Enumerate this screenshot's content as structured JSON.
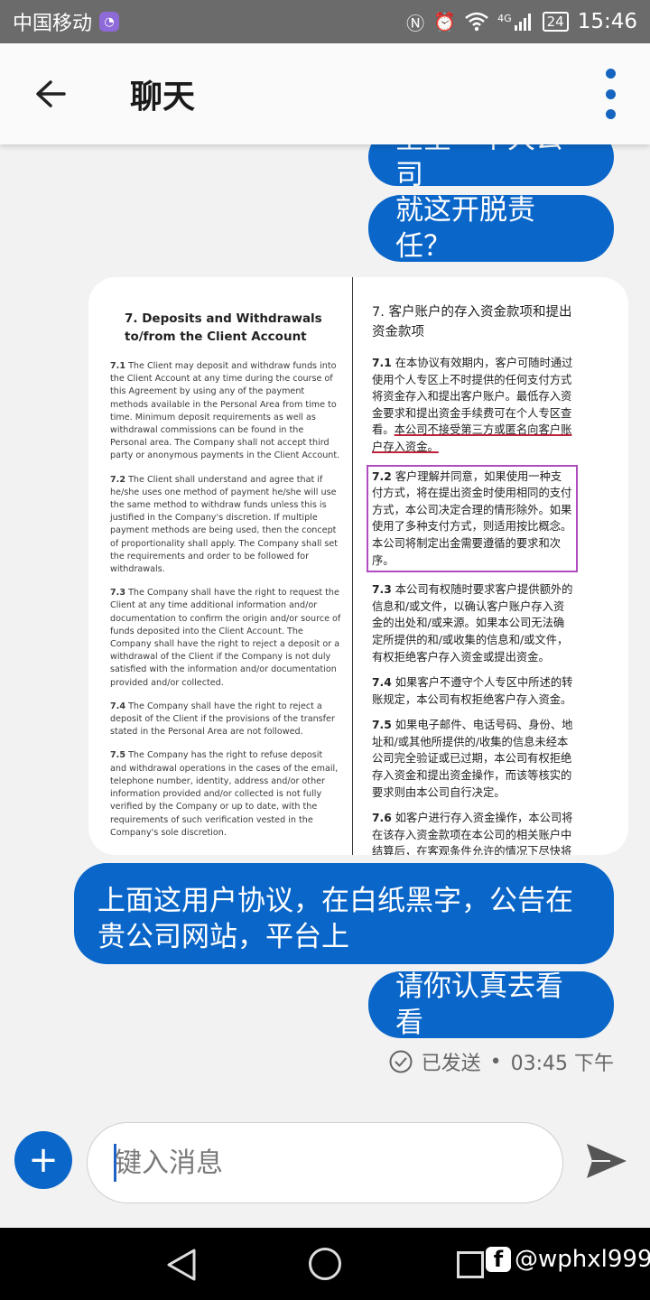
{
  "status_bar": {
    "carrier": "中国移动",
    "time": "15:46",
    "battery": "24",
    "network": "4G"
  },
  "header": {
    "title": "聊天"
  },
  "messages": [
    {
      "text": "堂堂一个大公司"
    },
    {
      "text": "就这开脱责任？"
    },
    {
      "text": "上面这用户协议，在白纸黑字，公告在贵公司网站，平台上"
    },
    {
      "text": "请你认真去看看"
    }
  ],
  "document": {
    "en_title": "7. Deposits and Withdrawals to/from the Client Account",
    "en_paragraphs": [
      {
        "num": "7.1",
        "text": "The Client may deposit and withdraw funds into the Client Account at any time during the course of this Agreement by using any of the payment methods available in the Personal Area from time to time. Minimum deposit requirements as well as withdrawal commissions can be found in the Personal area. The Company shall not accept third party or anonymous payments in the Client Account."
      },
      {
        "num": "7.2",
        "text": "The Client shall understand and agree that if he/she uses one method of payment he/she will use the same method to withdraw funds unless this is justified in the Company's discretion. If multiple payment methods are being used, then the concept of proportionality shall apply. The Company shall set the requirements and order to be followed for withdrawals."
      },
      {
        "num": "7.3",
        "text": "The Company shall have the right to request the Client at any time additional information and/or documentation to confirm the origin and/or source of funds deposited into the Client Account. The Company shall have the right to reject a deposit or a withdrawal of the Client if the Company is not duly satisfied with the information and/or documentation provided and/or collected."
      },
      {
        "num": "7.4",
        "text": "The Company shall have the right to reject a deposit of the Client if the provisions of the transfer stated in the Personal Area are not followed."
      },
      {
        "num": "7.5",
        "text": "The Company has the right to refuse deposit and withdrawal operations in the cases of the email, telephone number, identity, address and/or other information provided and/or collected is not fully verified by the Company or up to date, with the requirements of such verification vested in the Company's sole discretion."
      }
    ],
    "cn_title": "7. 客户账户的存入资金款项和提出资金款项",
    "cn_p1_num": "7.1",
    "cn_p1_text": "在本协议有效期内，客户可随时通过使用个人专区上不时提供的任何支付方式将资金存入和提出客户账户。最低存入资金要求和提出资金手续费可在个人专区查看。",
    "cn_p1_underlined": "本公司不接受第三方或匿名向客户账户存入资金。",
    "cn_p2_num": "7.2",
    "cn_p2_text": "客户理解并同意，如果使用一种支付方式，将在提出资金时使用相同的支付方式，本公司决定合理的情形除外。如果使用了多种支付方式，则适用按比概念。本公司将制定出金需要遵循的要求和次序。",
    "cn_p3_num": "7.3",
    "cn_p3_text": "本公司有权随时要求客户提供额外的信息和/或文件，以确认客户账户存入资金的出处和/或来源。如果本公司无法确定所提供的和/或收集的信息和/或文件，有权拒绝客户存入资金或提出资金。",
    "cn_p4_num": "7.4",
    "cn_p4_text": "如果客户不遵守个人专区中所述的转账规定，本公司有权拒绝客户存入资金。",
    "cn_p5_num": "7.5",
    "cn_p5_text": "如果电子邮件、电话号码、身份、地址和/或其他所提供的/收集的信息未经本公司完全验证或已过期，本公司有权拒绝存入资金和提出资金操作，而该等核实的要求则由本公司自行决定。",
    "cn_p6_num": "7.6",
    "cn_p6_text": "如客户进行存入资金操作，本公司将在该存入资金款项在本公司的相关账户中结算后，在客观条件允许的情况下尽快将相关实际收到的金额存入相关客户"
  },
  "delivery": {
    "status": "已发送",
    "separator": "•",
    "time": "03:45 下午"
  },
  "input": {
    "placeholder": "键入消息"
  },
  "watermark": {
    "logo": "f",
    "handle": "@wphxl999"
  },
  "colors": {
    "accent": "#0a66c8",
    "statusbar": "#6b6b6b"
  }
}
